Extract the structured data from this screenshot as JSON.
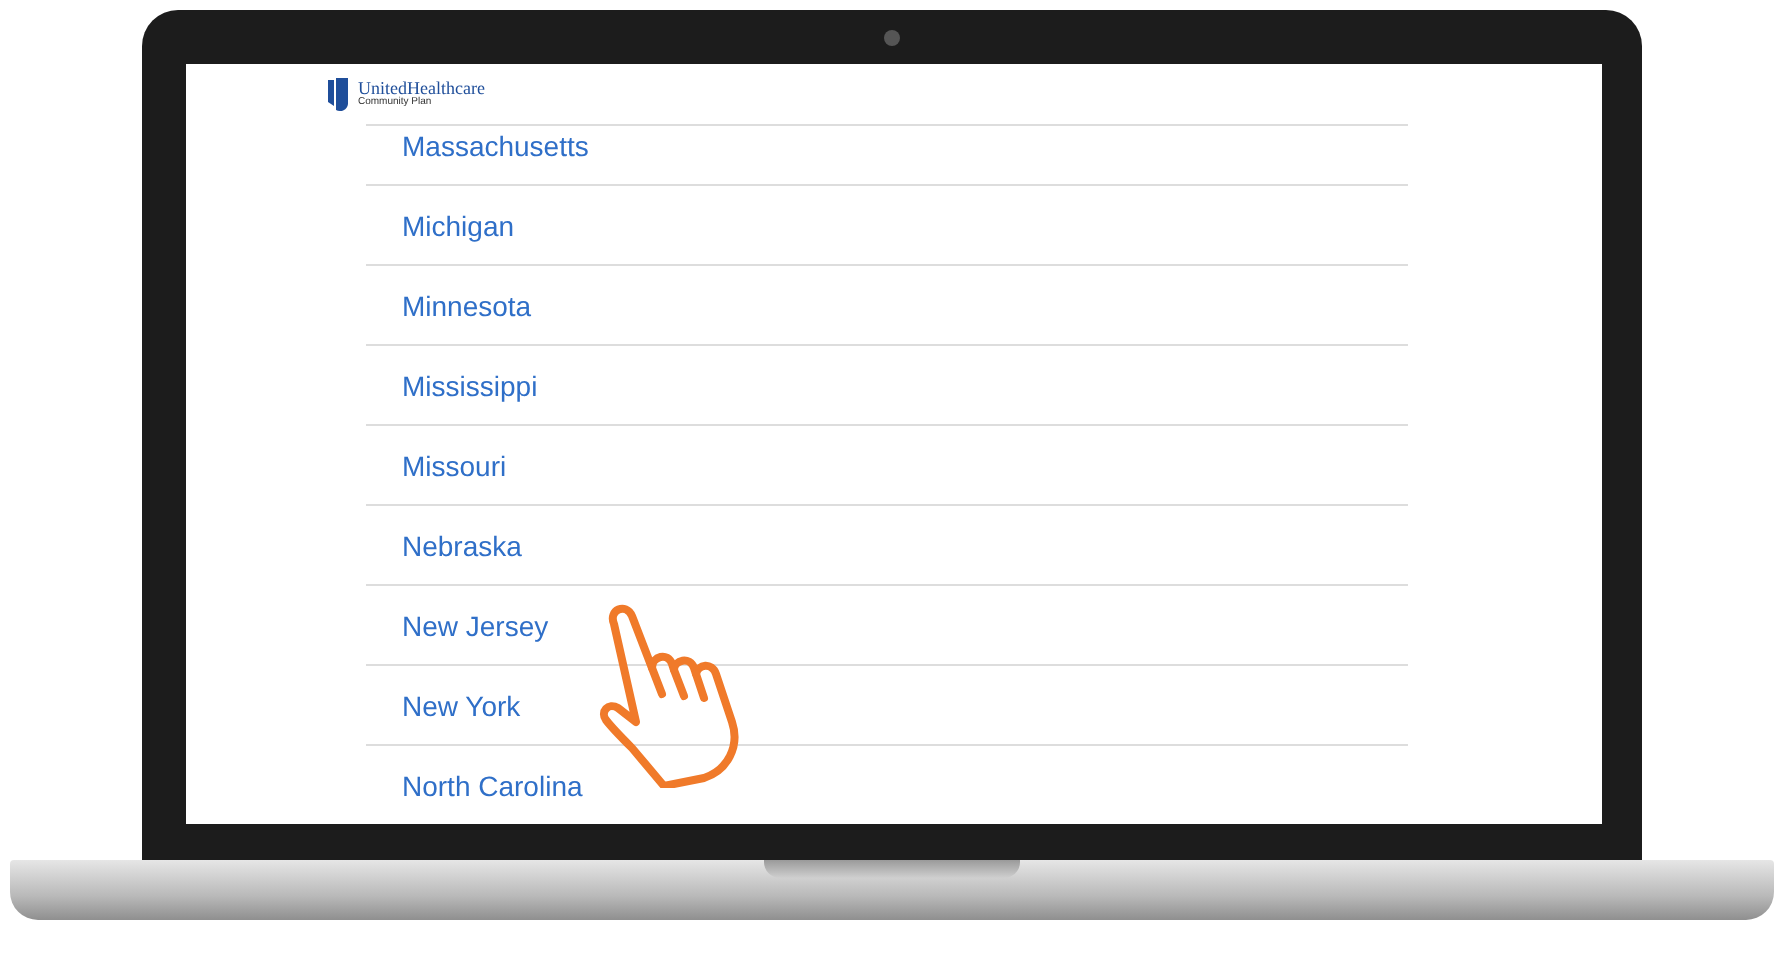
{
  "logo": {
    "name": "UnitedHealthcare",
    "subtitle": "Community Plan"
  },
  "states": [
    {
      "label": "Massachusetts"
    },
    {
      "label": "Michigan"
    },
    {
      "label": "Minnesota"
    },
    {
      "label": "Mississippi"
    },
    {
      "label": "Missouri"
    },
    {
      "label": "Nebraska"
    },
    {
      "label": "New Jersey"
    },
    {
      "label": "New York"
    },
    {
      "label": "North Carolina"
    }
  ]
}
